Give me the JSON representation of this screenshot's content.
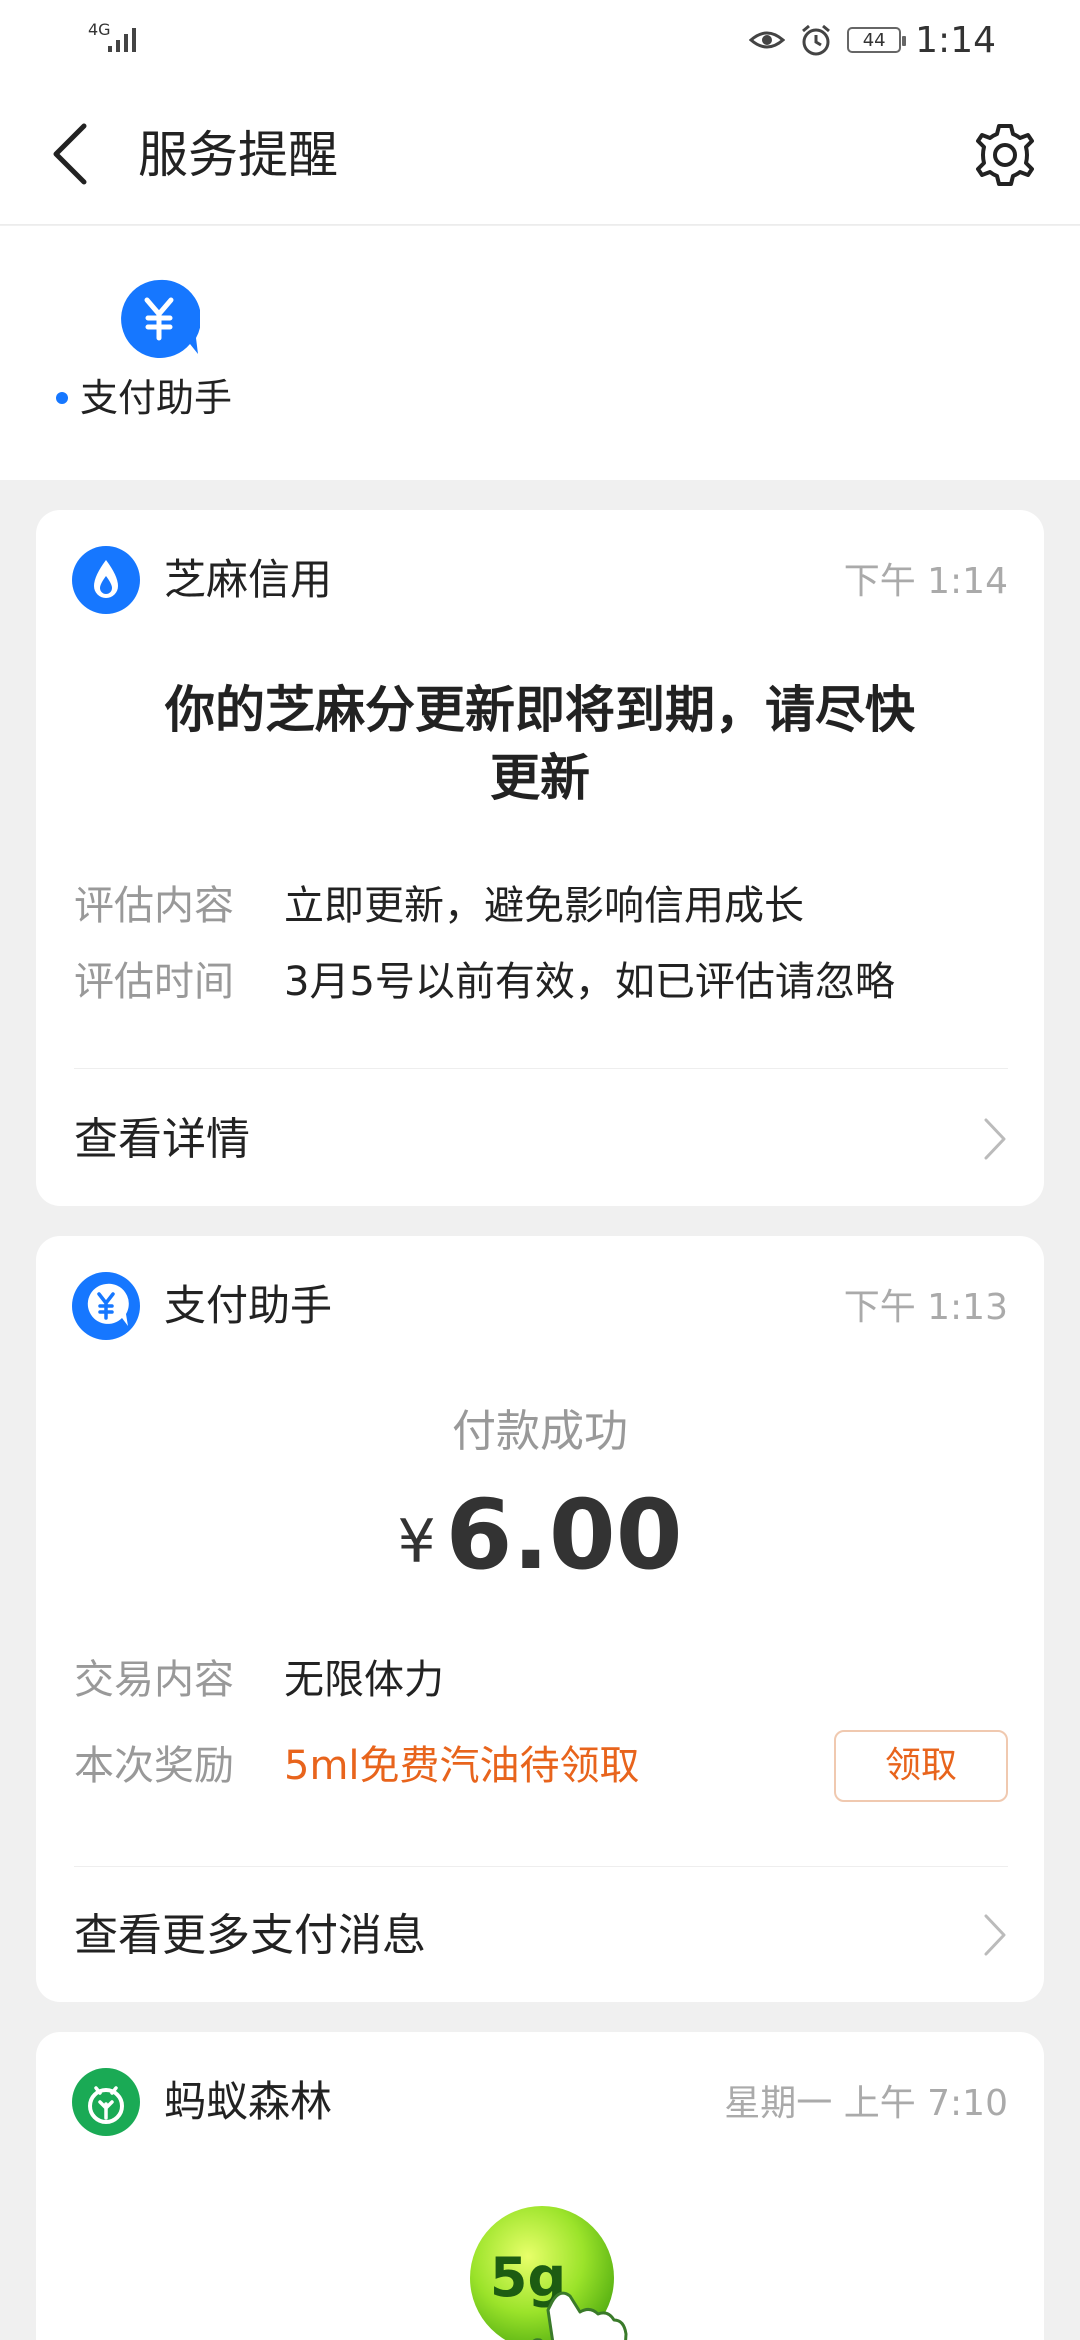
{
  "status_bar": {
    "network": "4G",
    "time": "1:14",
    "battery": "44"
  },
  "header": {
    "title": "服务提醒"
  },
  "tabs": [
    {
      "label": "支付助手"
    }
  ],
  "cards": {
    "zhima": {
      "source": "芝麻信用",
      "time": "下午 1:14",
      "headline": "你的芝麻分更新即将到期，请尽快更新",
      "rows": [
        {
          "label": "评估内容",
          "value": "立即更新，避免影响信用成长"
        },
        {
          "label": "评估时间",
          "value": "3月5号以前有效，如已评估请忽略"
        }
      ],
      "link": "查看详情"
    },
    "payment": {
      "source": "支付助手",
      "time": "下午 1:13",
      "status": "付款成功",
      "currency": "¥",
      "amount": "6.00",
      "rows": [
        {
          "label": "交易内容",
          "value": "无限体力"
        },
        {
          "label": "本次奖励",
          "value": "5ml免费汽油待领取"
        }
      ],
      "claim_button": "领取",
      "link": "查看更多支付消息"
    },
    "forest": {
      "source": "蚂蚁森林",
      "time": "星期一 上午 7:10",
      "energy": "5g"
    }
  },
  "colors": {
    "accent": "#1677ff",
    "reward": "#e8641c",
    "forest": "#1aaa55"
  }
}
